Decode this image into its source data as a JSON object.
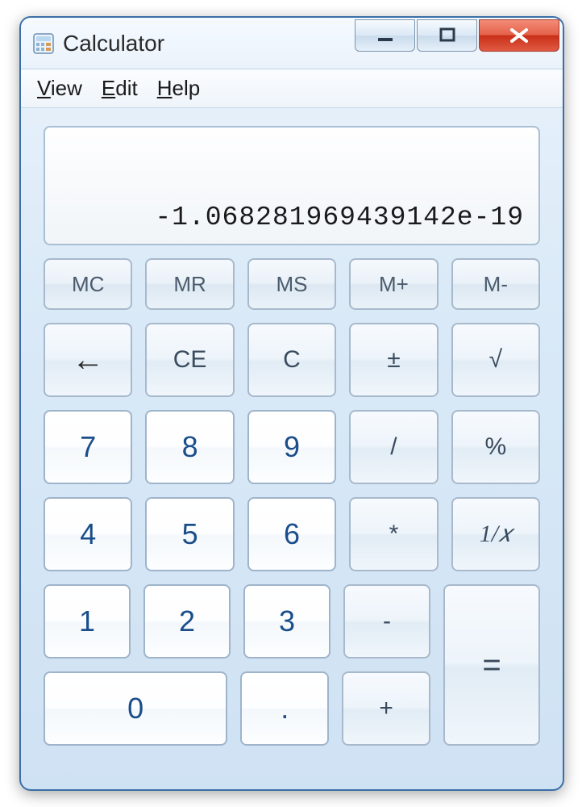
{
  "window": {
    "title": "Calculator"
  },
  "menu": {
    "view": "View",
    "edit": "Edit",
    "help": "Help"
  },
  "display": {
    "value": "-1.068281969439142e-19"
  },
  "buttons": {
    "memory": {
      "mc": "MC",
      "mr": "MR",
      "ms": "MS",
      "mplus": "M+",
      "mminus": "M-"
    },
    "edit": {
      "back": "←",
      "ce": "CE",
      "c": "C",
      "negate": "±",
      "sqrt": "√"
    },
    "nums": {
      "n0": "0",
      "n1": "1",
      "n2": "2",
      "n3": "3",
      "n4": "4",
      "n5": "5",
      "n6": "6",
      "n7": "7",
      "n8": "8",
      "n9": "9",
      "dot": "."
    },
    "ops": {
      "div": "/",
      "mul": "*",
      "sub": "-",
      "add": "+",
      "eq": "="
    },
    "funcs": {
      "pct": "%",
      "recip": "1/𝑥"
    }
  }
}
